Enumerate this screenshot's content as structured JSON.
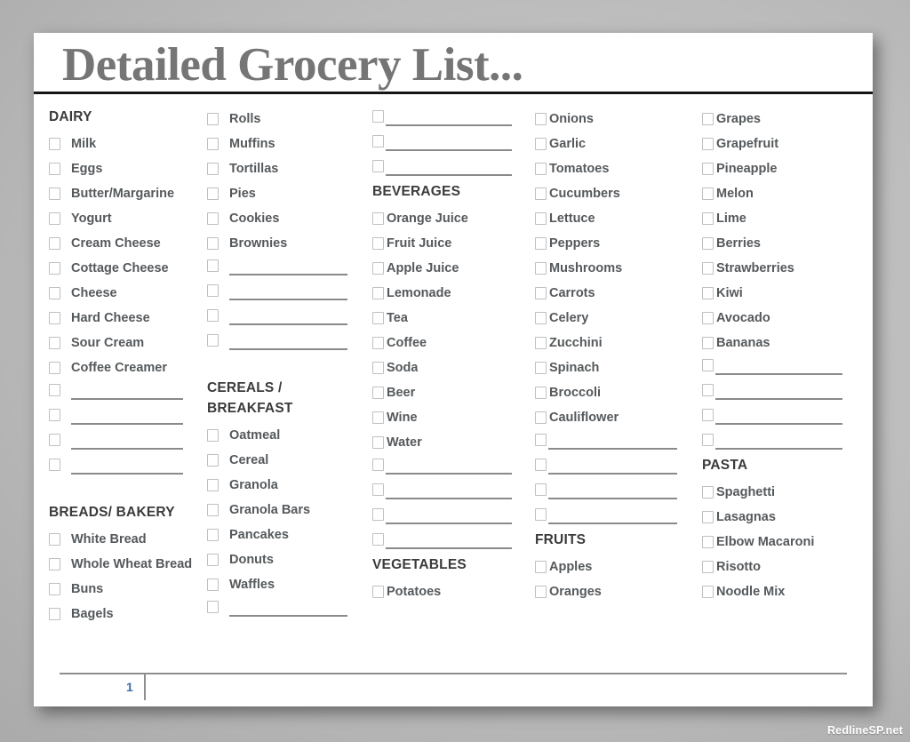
{
  "document": {
    "title": "Detailed Grocery List...",
    "page_number": "1",
    "watermark": "RedlineSP.net"
  },
  "columns": [
    {
      "id": "col-1",
      "gap": "wide",
      "blocks": [
        {
          "heading": "DAIRY",
          "heading_top_space": false,
          "items": [
            {
              "label": "Milk",
              "blank": false
            },
            {
              "label": "Eggs",
              "blank": false
            },
            {
              "label": "Butter/Margarine",
              "blank": false
            },
            {
              "label": "Yogurt",
              "blank": false
            },
            {
              "label": "Cream Cheese",
              "blank": false
            },
            {
              "label": "Cottage Cheese",
              "blank": false
            },
            {
              "label": "Cheese",
              "blank": false
            },
            {
              "label": "Hard Cheese",
              "blank": false
            },
            {
              "label": "Sour Cream",
              "blank": false
            },
            {
              "label": "Coffee Creamer",
              "blank": false
            },
            {
              "label": "",
              "blank": true
            },
            {
              "label": "",
              "blank": true
            },
            {
              "label": "",
              "blank": true
            },
            {
              "label": "",
              "blank": true
            }
          ]
        },
        {
          "heading": "BREADS/ BAKERY",
          "heading_top_space": true,
          "items": [
            {
              "label": "White Bread",
              "blank": false
            },
            {
              "label": "Whole Wheat Bread",
              "blank": false
            },
            {
              "label": "Buns",
              "blank": false
            },
            {
              "label": "Bagels",
              "blank": false
            }
          ]
        }
      ]
    },
    {
      "id": "col-2",
      "gap": "wide",
      "blocks": [
        {
          "heading": "",
          "heading_top_space": false,
          "items": [
            {
              "label": "Rolls",
              "blank": false
            },
            {
              "label": "Muffins",
              "blank": false
            },
            {
              "label": "Tortillas",
              "blank": false
            },
            {
              "label": "Pies",
              "blank": false
            },
            {
              "label": "Cookies",
              "blank": false
            },
            {
              "label": "Brownies",
              "blank": false
            },
            {
              "label": "",
              "blank": true
            },
            {
              "label": "",
              "blank": true
            },
            {
              "label": "",
              "blank": true
            },
            {
              "label": "",
              "blank": true
            }
          ]
        },
        {
          "heading": "CEREALS /\nBREAKFAST",
          "heading_top_space": true,
          "items": [
            {
              "label": "Oatmeal",
              "blank": false
            },
            {
              "label": "Cereal",
              "blank": false
            },
            {
              "label": "Granola",
              "blank": false
            },
            {
              "label": "Granola Bars",
              "blank": false
            },
            {
              "label": "Pancakes",
              "blank": false
            },
            {
              "label": "Donuts",
              "blank": false
            },
            {
              "label": "Waffles",
              "blank": false
            },
            {
              "label": "",
              "blank": true
            }
          ]
        }
      ]
    },
    {
      "id": "col-3",
      "gap": "tight",
      "blocks": [
        {
          "heading": "",
          "heading_top_space": false,
          "items": [
            {
              "label": "",
              "blank": true
            },
            {
              "label": "",
              "blank": true
            },
            {
              "label": "",
              "blank": true
            }
          ]
        },
        {
          "heading": "BEVERAGES",
          "heading_top_space": false,
          "items": [
            {
              "label": "Orange Juice",
              "blank": false
            },
            {
              "label": "Fruit Juice",
              "blank": false
            },
            {
              "label": "Apple Juice",
              "blank": false
            },
            {
              "label": "Lemonade",
              "blank": false
            },
            {
              "label": "Tea",
              "blank": false
            },
            {
              "label": "Coffee",
              "blank": false
            },
            {
              "label": "Soda",
              "blank": false
            },
            {
              "label": "Beer",
              "blank": false
            },
            {
              "label": "Wine",
              "blank": false
            },
            {
              "label": "Water",
              "blank": false
            },
            {
              "label": "",
              "blank": true
            },
            {
              "label": "",
              "blank": true
            },
            {
              "label": "",
              "blank": true
            },
            {
              "label": "",
              "blank": true
            }
          ]
        },
        {
          "heading": "VEGETABLES",
          "heading_top_space": false,
          "items": [
            {
              "label": "Potatoes",
              "blank": false
            }
          ]
        }
      ]
    },
    {
      "id": "col-4",
      "gap": "tight",
      "blocks": [
        {
          "heading": "",
          "heading_top_space": false,
          "items": [
            {
              "label": "Onions",
              "blank": false
            },
            {
              "label": "Garlic",
              "blank": false
            },
            {
              "label": "Tomatoes",
              "blank": false
            },
            {
              "label": "Cucumbers",
              "blank": false
            },
            {
              "label": "Lettuce",
              "blank": false
            },
            {
              "label": "Peppers",
              "blank": false
            },
            {
              "label": "Mushrooms",
              "blank": false
            },
            {
              "label": "Carrots",
              "blank": false
            },
            {
              "label": "Celery",
              "blank": false
            },
            {
              "label": "Zucchini",
              "blank": false
            },
            {
              "label": "Spinach",
              "blank": false
            },
            {
              "label": "Broccoli",
              "blank": false
            },
            {
              "label": "Cauliflower",
              "blank": false
            },
            {
              "label": "",
              "blank": true
            },
            {
              "label": "",
              "blank": true
            },
            {
              "label": "",
              "blank": true
            },
            {
              "label": "",
              "blank": true
            }
          ]
        },
        {
          "heading": "FRUITS",
          "heading_top_space": false,
          "items": [
            {
              "label": "Apples",
              "blank": false
            },
            {
              "label": "Oranges",
              "blank": false
            }
          ]
        }
      ]
    },
    {
      "id": "col-5",
      "gap": "tight",
      "blocks": [
        {
          "heading": "",
          "heading_top_space": false,
          "items": [
            {
              "label": "Grapes",
              "blank": false
            },
            {
              "label": "Grapefruit",
              "blank": false
            },
            {
              "label": "Pineapple",
              "blank": false
            },
            {
              "label": "Melon",
              "blank": false
            },
            {
              "label": "Lime",
              "blank": false
            },
            {
              "label": "Berries",
              "blank": false
            },
            {
              "label": "Strawberries",
              "blank": false
            },
            {
              "label": "Kiwi",
              "blank": false
            },
            {
              "label": "Avocado",
              "blank": false
            },
            {
              "label": "Bananas",
              "blank": false
            },
            {
              "label": "",
              "blank": true
            },
            {
              "label": "",
              "blank": true
            },
            {
              "label": "",
              "blank": true
            },
            {
              "label": "",
              "blank": true
            }
          ]
        },
        {
          "heading": "PASTA",
          "heading_top_space": false,
          "items": [
            {
              "label": "Spaghetti",
              "blank": false
            },
            {
              "label": "Lasagnas",
              "blank": false
            },
            {
              "label": "Elbow Macaroni",
              "blank": false
            },
            {
              "label": "Risotto",
              "blank": false
            },
            {
              "label": "Noodle Mix",
              "blank": false
            }
          ]
        }
      ]
    }
  ]
}
